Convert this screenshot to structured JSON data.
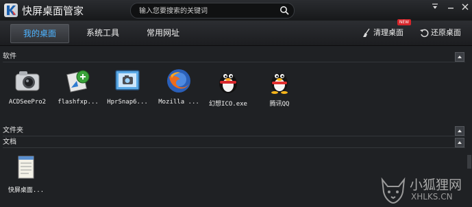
{
  "app": {
    "title": "快屏桌面管家"
  },
  "search": {
    "placeholder": "输入您要搜索的关键词"
  },
  "tabs": [
    {
      "label": "我的桌面",
      "active": true
    },
    {
      "label": "系统工具",
      "active": false
    },
    {
      "label": "常用网址",
      "active": false
    }
  ],
  "tools": {
    "clean_label": "清理桌面",
    "restore_label": "还原桌面",
    "new_badge": "NEW"
  },
  "sections": {
    "software": "软件",
    "folders": "文件夹",
    "docs": "文档"
  },
  "software_items": [
    {
      "label": "ACDSeePro2",
      "icon": "camera-icon"
    },
    {
      "label": "flashfxp...",
      "icon": "flashfxp-icon"
    },
    {
      "label": "HprSnap6...",
      "icon": "hypersnap-icon"
    },
    {
      "label": "Mozilla ...",
      "icon": "firefox-icon"
    },
    {
      "label": "幻想ICO.exe",
      "icon": "penguin-icon"
    },
    {
      "label": "腾讯QQ",
      "icon": "qq-penguin-icon"
    }
  ],
  "doc_items": [
    {
      "label": "快屏桌面...",
      "icon": "notepad-icon"
    }
  ],
  "watermark": {
    "text": "小狐狸网",
    "url": "XHLKS.CN"
  },
  "colors": {
    "accent": "#4db3ff",
    "background": "#1f2124",
    "badge": "#d8262b"
  }
}
